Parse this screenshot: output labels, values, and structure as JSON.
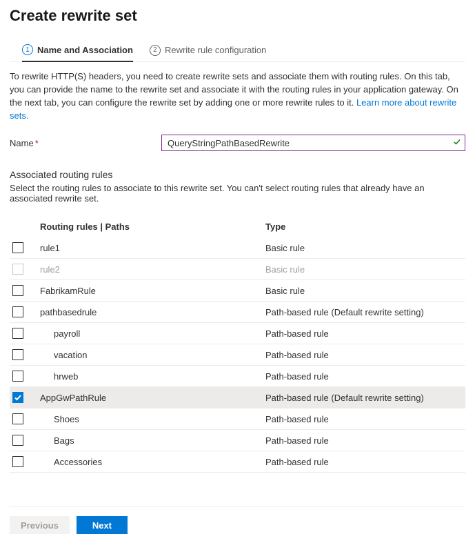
{
  "title": "Create rewrite set",
  "steps": [
    {
      "num": "1",
      "label": "Name and Association",
      "active": true
    },
    {
      "num": "2",
      "label": "Rewrite rule configuration",
      "active": false
    }
  ],
  "intro_text": "To rewrite HTTP(S) headers, you need to create rewrite sets and associate them with routing rules. On this tab, you can provide the name to the rewrite set and associate it with the routing rules in your application gateway. On the next tab, you can configure the rewrite set by adding one or more rewrite rules to it.  ",
  "learn_more_label": "Learn more about rewrite sets.",
  "name_label": "Name",
  "name_value": "QueryStringPathBasedRewrite",
  "section_heading": "Associated routing rules",
  "section_sub": "Select the routing rules to associate to this rewrite set. You can't select routing rules that already have an associated rewrite set.",
  "table_header_name": "Routing rules | Paths",
  "table_header_type": "Type",
  "rules": [
    {
      "name": "rule1",
      "type": "Basic rule",
      "checked": false,
      "disabled": false,
      "indent": false
    },
    {
      "name": "rule2",
      "type": "Basic rule",
      "checked": false,
      "disabled": true,
      "indent": false
    },
    {
      "name": "FabrikamRule",
      "type": "Basic rule",
      "checked": false,
      "disabled": false,
      "indent": false
    },
    {
      "name": "pathbasedrule",
      "type": "Path-based rule (Default rewrite setting)",
      "checked": false,
      "disabled": false,
      "indent": false
    },
    {
      "name": "payroll",
      "type": "Path-based rule",
      "checked": false,
      "disabled": false,
      "indent": true
    },
    {
      "name": "vacation",
      "type": "Path-based rule",
      "checked": false,
      "disabled": false,
      "indent": true
    },
    {
      "name": "hrweb",
      "type": "Path-based rule",
      "checked": false,
      "disabled": false,
      "indent": true
    },
    {
      "name": "AppGwPathRule",
      "type": "Path-based rule (Default rewrite setting)",
      "checked": true,
      "disabled": false,
      "indent": false
    },
    {
      "name": "Shoes",
      "type": "Path-based rule",
      "checked": false,
      "disabled": false,
      "indent": true
    },
    {
      "name": "Bags",
      "type": "Path-based rule",
      "checked": false,
      "disabled": false,
      "indent": true
    },
    {
      "name": "Accessories",
      "type": "Path-based rule",
      "checked": false,
      "disabled": false,
      "indent": true
    }
  ],
  "buttons": {
    "previous": "Previous",
    "next": "Next"
  }
}
